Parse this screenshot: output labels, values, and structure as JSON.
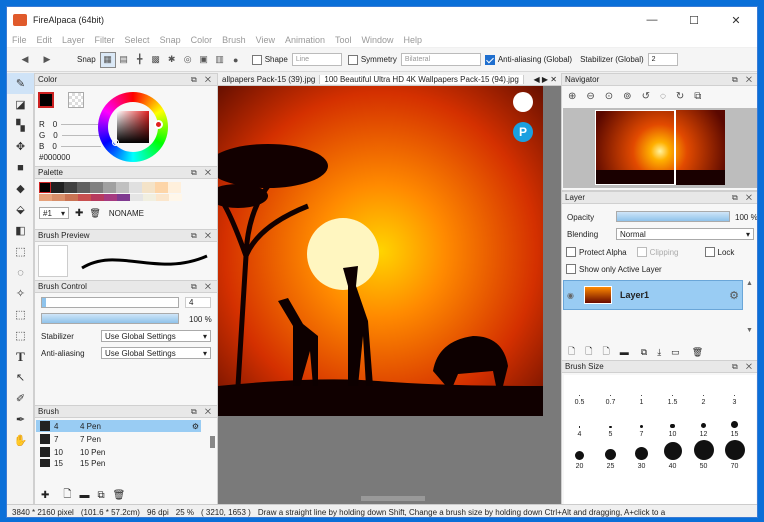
{
  "window": {
    "title": "FireAlpaca (64bit)",
    "minimize": "—",
    "maximize": "☐",
    "close": "✕"
  },
  "menu": [
    "File",
    "Edit",
    "Layer",
    "Filter",
    "Select",
    "Snap",
    "Color",
    "Brush",
    "View",
    "Animation",
    "Tool",
    "Window",
    "Help"
  ],
  "toolbar": {
    "snap": "Snap",
    "shape": "Shape",
    "shape_value": "Line",
    "symmetry": "Symmetry",
    "symmetry_value": "Bilateral",
    "antialias": "Anti-aliasing (Global)",
    "stabilizer": "Stabilizer (Global)",
    "stabilizer_value": "2"
  },
  "tabs": [
    "allpapers Pack-15 (39).jpg",
    "100 Beautiful Ultra HD 4K Wallpapers Pack-15 (94).jpg"
  ],
  "color": {
    "title": "Color",
    "r": "R",
    "g": "G",
    "b": "B",
    "r_val": "0",
    "g_val": "0",
    "b_val": "0",
    "hex": "#000000"
  },
  "palette": {
    "title": "Palette",
    "set": "#1",
    "name": "NONAME"
  },
  "brush_preview": {
    "title": "Brush Preview"
  },
  "brush_control": {
    "title": "Brush Control",
    "size": "4",
    "opacity": "100 %",
    "stabilizer_label": "Stabilizer",
    "stabilizer_value": "Use Global Settings",
    "antialias_label": "Anti-aliasing",
    "antialias_value": "Use Global Settings"
  },
  "brush": {
    "title": "Brush",
    "items": [
      {
        "num": "4",
        "name": "4 Pen"
      },
      {
        "num": "7",
        "name": "7 Pen"
      },
      {
        "num": "10",
        "name": "10 Pen"
      },
      {
        "num": "15",
        "name": "15 Pen"
      }
    ]
  },
  "navigator": {
    "title": "Navigator"
  },
  "layer": {
    "title": "Layer",
    "opacity_label": "Opacity",
    "opacity_value": "100 %",
    "blending_label": "Blending",
    "blending_value": "Normal",
    "protect_alpha": "Protect Alpha",
    "clipping": "Clipping",
    "lock": "Lock",
    "show_only": "Show only Active Layer",
    "layer_name": "Layer1"
  },
  "brush_size": {
    "title": "Brush Size",
    "sizes": [
      "0.5",
      "0.7",
      "1",
      "1.5",
      "2",
      "3",
      "4",
      "5",
      "7",
      "10",
      "12",
      "15",
      "20",
      "25",
      "30",
      "40",
      "50",
      "70"
    ]
  },
  "status": {
    "pixels": "3840 * 2160 pixel",
    "cm": "(101.6 * 57.2cm)",
    "dpi": "96 dpi",
    "zoom": "25 %",
    "coords": "( 3210, 1653 )",
    "hint": "Draw a straight line by holding down Shift, Change a brush size by holding down Ctrl+Alt and dragging, A+click to a"
  }
}
